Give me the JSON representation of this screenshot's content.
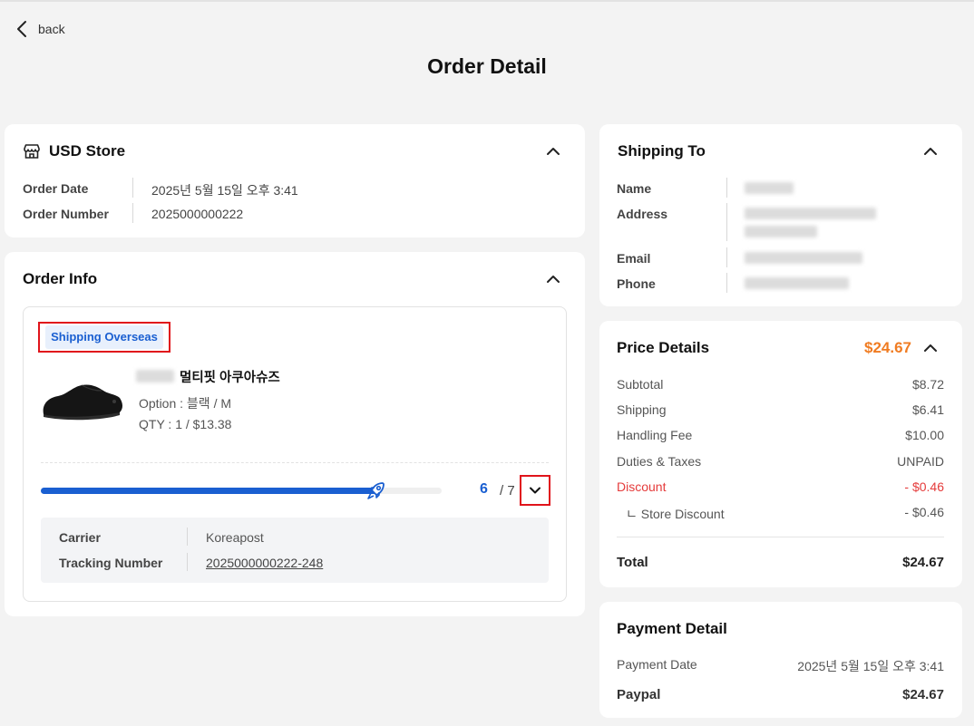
{
  "header": {
    "back_label": "back",
    "page_title": "Order Detail"
  },
  "store_card": {
    "title": "USD Store",
    "order_date_label": "Order Date",
    "order_date_value": "2025년 5월 15일 오후 3:41",
    "order_number_label": "Order Number",
    "order_number_value": "2025000000222"
  },
  "order_info": {
    "title": "Order Info",
    "badge": "Shipping Overseas",
    "product_name": "멀티핏 아쿠아슈즈",
    "option": "Option : 블랙 / M",
    "qty": "QTY : 1 / $13.38",
    "progress_current": "6",
    "progress_total": "/ 7",
    "progress_fraction": 0.84,
    "carrier_label": "Carrier",
    "carrier_value": "Koreapost",
    "tracking_label": "Tracking Number",
    "tracking_value": "2025000000222-248"
  },
  "shipping_to": {
    "title": "Shipping To",
    "name_label": "Name",
    "address_label": "Address",
    "email_label": "Email",
    "phone_label": "Phone"
  },
  "price_details": {
    "title": "Price Details",
    "total_header": "$24.67",
    "subtotal_label": "Subtotal",
    "subtotal_value": "$8.72",
    "shipping_label": "Shipping",
    "shipping_value": "$6.41",
    "handling_label": "Handling Fee",
    "handling_value": "$10.00",
    "duties_label": "Duties & Taxes",
    "duties_value": "UNPAID",
    "discount_label": "Discount",
    "discount_value": "- $0.46",
    "store_discount_label": "ㄴ Store Discount",
    "store_discount_value": "- $0.46",
    "total_label": "Total",
    "total_value": "$24.67"
  },
  "payment_detail": {
    "title": "Payment Detail",
    "date_label": "Payment Date",
    "date_value": "2025년 5월 15일 오후 3:41",
    "method_label": "Paypal",
    "method_value": "$24.67"
  },
  "colors": {
    "accent_blue": "#1a5fd1",
    "price_orange": "#f07c22",
    "discount_red": "#e53b3b",
    "highlight_red": "#e0141b"
  }
}
